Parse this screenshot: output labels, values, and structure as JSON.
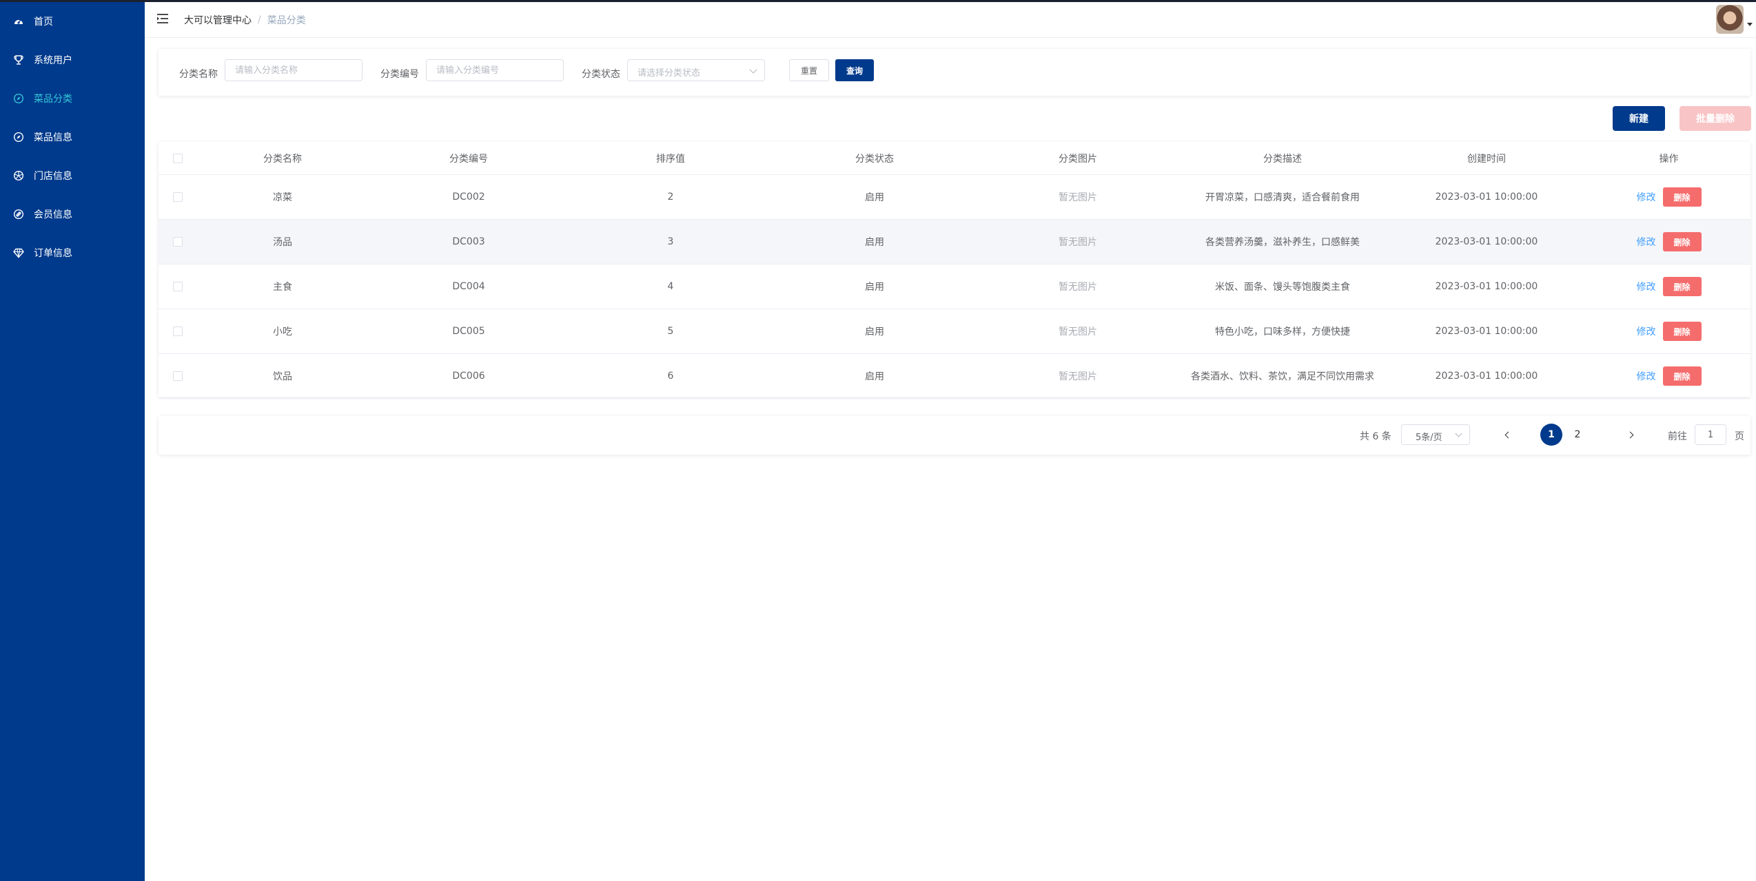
{
  "sidebar": {
    "items": [
      {
        "label": "首页",
        "icon": "dashboard-icon",
        "active": false
      },
      {
        "label": "系统用户",
        "icon": "trophy-icon",
        "active": false
      },
      {
        "label": "菜品分类",
        "icon": "compass-icon",
        "active": true
      },
      {
        "label": "菜品信息",
        "icon": "compass-icon",
        "active": false
      },
      {
        "label": "门店信息",
        "icon": "aperture-icon",
        "active": false
      },
      {
        "label": "会员信息",
        "icon": "link-icon",
        "active": false
      },
      {
        "label": "订单信息",
        "icon": "diamond-icon",
        "active": false
      }
    ],
    "accent": "#003a8c",
    "active_color": "#35c7d8"
  },
  "header": {
    "breadcrumb_home": "大可以管理中心",
    "breadcrumb_sep": "/",
    "breadcrumb_current": "菜品分类"
  },
  "search": {
    "name_label": "分类名称",
    "name_placeholder": "请输入分类名称",
    "code_label": "分类编号",
    "code_placeholder": "请输入分类编号",
    "status_label": "分类状态",
    "status_placeholder": "请选择分类状态",
    "reset_label": "重置",
    "query_label": "查询"
  },
  "actions": {
    "new_label": "新建",
    "batch_delete_label": "批量删除"
  },
  "table": {
    "columns": [
      "分类名称",
      "分类编号",
      "排序值",
      "分类状态",
      "分类图片",
      "分类描述",
      "创建时间",
      "操作"
    ],
    "edit_label": "修改",
    "delete_label": "删除",
    "rows": [
      {
        "name": "凉菜",
        "code": "DC002",
        "sort": "2",
        "status": "启用",
        "image": "暂无图片",
        "desc": "开胃凉菜，口感清爽，适合餐前食用",
        "created": "2023-03-01 10:00:00"
      },
      {
        "name": "汤品",
        "code": "DC003",
        "sort": "3",
        "status": "启用",
        "image": "暂无图片",
        "desc": "各类营养汤羹，滋补养生，口感鲜美",
        "created": "2023-03-01 10:00:00"
      },
      {
        "name": "主食",
        "code": "DC004",
        "sort": "4",
        "status": "启用",
        "image": "暂无图片",
        "desc": "米饭、面条、馒头等饱腹类主食",
        "created": "2023-03-01 10:00:00"
      },
      {
        "name": "小吃",
        "code": "DC005",
        "sort": "5",
        "status": "启用",
        "image": "暂无图片",
        "desc": "特色小吃，口味多样，方便快捷",
        "created": "2023-03-01 10:00:00"
      },
      {
        "name": "饮品",
        "code": "DC006",
        "sort": "6",
        "status": "启用",
        "image": "暂无图片",
        "desc": "各类酒水、饮料、茶饮，满足不同饮用需求",
        "created": "2023-03-01 10:00:00"
      }
    ]
  },
  "pagination": {
    "total_text": "共 6 条",
    "page_size": "5条/页",
    "pages": [
      "1",
      "2"
    ],
    "current_page": "1",
    "goto_label": "前往",
    "goto_value": "1",
    "page_suffix": "页"
  }
}
